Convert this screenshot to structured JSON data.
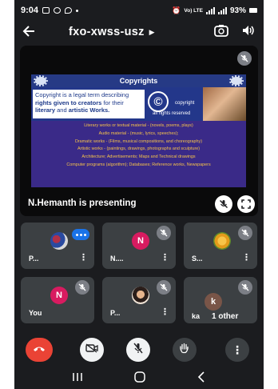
{
  "status_bar": {
    "time": "9:04",
    "network_text": "Vo) LTE",
    "battery_percent": "93%"
  },
  "header": {
    "title": "fxo-xwss-usz"
  },
  "presentation": {
    "presenter_label": "N.Hemanth is presenting",
    "slide": {
      "title": "Copyrights",
      "definition_pre": "Copyright is a legal term describing ",
      "definition_b1": "rights given to creators",
      "definition_mid": " for their ",
      "definition_b2": "literary",
      "definition_and": " and ",
      "definition_b3": "artistic Works.",
      "copyright_label": "copyright",
      "rights_label": "all rights reserved",
      "items": [
        "Literary works or textual material - (novels, poems, plays)",
        "Audio material - (music, lyrics, speeches);",
        "Dramatic works - (Films, musical compositions, and choreography)",
        "Artistic works - (paintings, drawings, photographs and sculpture)",
        "Architecture; Advertisements; Maps and Technical drawings",
        "Computer programs (algorithm); Databases; Reference works, Newspapers"
      ]
    }
  },
  "participants": [
    {
      "name": "P...",
      "initial": "",
      "muted": false,
      "speaking": true
    },
    {
      "name": "N....",
      "initial": "N",
      "muted": true,
      "speaking": false
    },
    {
      "name": "S...",
      "initial": "",
      "muted": true,
      "speaking": false
    },
    {
      "name": "You",
      "initial": "N",
      "muted": true,
      "speaking": false
    },
    {
      "name": "P...",
      "initial": "",
      "muted": true,
      "speaking": false
    },
    {
      "name": "ka",
      "initial": "k",
      "muted": true,
      "speaking": false,
      "others_label": "1 other"
    }
  ],
  "colors": {
    "background": "#1b1c1f",
    "tile": "#3c4043",
    "end_call": "#ea4335",
    "avatar_pink": "#d81b60",
    "avatar_brown": "#795548",
    "speaking_blue": "#1a73e8"
  },
  "icons": {
    "back": "arrow-left-icon",
    "caret": "caret-right-icon",
    "camera_switch": "camera-flip-icon",
    "audio": "speaker-icon",
    "mic_off": "mic-off-icon",
    "fullscreen": "fullscreen-icon",
    "end_call": "phone-end-icon",
    "camera_off": "camera-off-icon",
    "raise_hand": "hand-icon",
    "more": "more-vert-icon"
  }
}
